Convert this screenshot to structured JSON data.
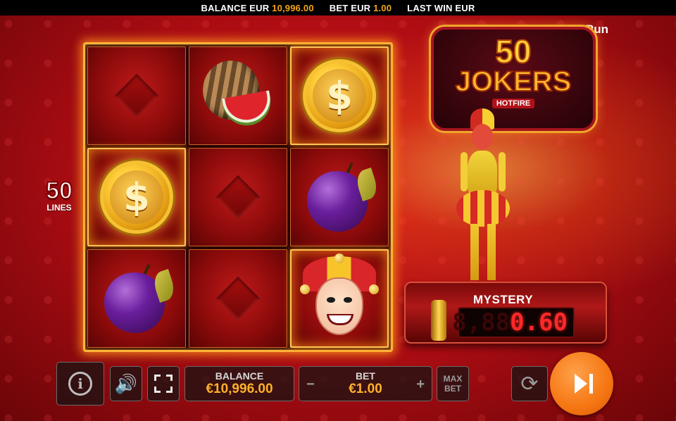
{
  "topbar": {
    "balance_label": "BALANCE EUR",
    "balance_value": "10,996.00",
    "bet_label": "BET EUR",
    "bet_value": "1.00",
    "last_win_label": "LAST WIN EUR",
    "last_win_value": ""
  },
  "brand": {
    "name": "ceRun",
    "icon": "spade-icon"
  },
  "logo": {
    "number": "50",
    "title": "JOKERS",
    "subtitle": "HOTFIRE"
  },
  "lines": {
    "count": "50",
    "label": "LINES"
  },
  "reels": {
    "grid": [
      [
        "diamond",
        "watermelon",
        "dollar-coin"
      ],
      [
        "dollar-coin",
        "diamond",
        "plum"
      ],
      [
        "plum",
        "diamond",
        "joker"
      ]
    ],
    "hot_cells": [
      "0-2",
      "1-0",
      "2-2"
    ],
    "coin_symbol": "$"
  },
  "mystery": {
    "title": "MYSTERY",
    "ghost_digits": "8,88",
    "value": "0.60"
  },
  "controls": {
    "info_symbol": "i",
    "balance_label": "BALANCE",
    "balance_value": "€10,996.00",
    "bet_label": "BET",
    "bet_value": "€1.00",
    "bet_minus": "−",
    "bet_plus": "+",
    "max_bet_line1": "MAX",
    "max_bet_line2": "BET",
    "sound_symbol": "🔊",
    "autoplay_symbol": "⟳"
  },
  "colors": {
    "accent": "#ffb12a",
    "spin": "#f57612",
    "background": "#b00e14"
  }
}
